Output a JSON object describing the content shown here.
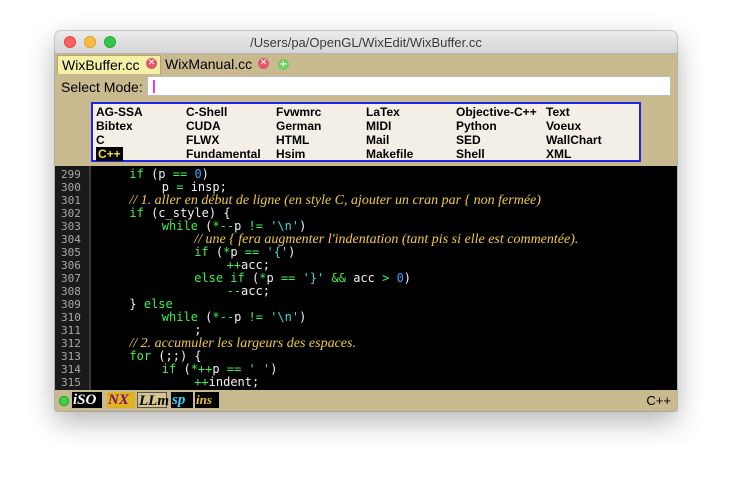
{
  "window": {
    "title": "/Users/pa/OpenGL/WixEdit/WixBuffer.cc"
  },
  "tabs": [
    {
      "label": "WixBuffer.cc",
      "active": true
    },
    {
      "label": "WixManual.cc",
      "active": false
    }
  ],
  "mode_select": {
    "label": "Select Mode:",
    "value": ""
  },
  "modes": [
    [
      "AG-SSA",
      "Bibtex",
      "C",
      "C++"
    ],
    [
      "C-Shell",
      "CUDA",
      "FLWX",
      "Fundamental"
    ],
    [
      "Fvwmrc",
      "German",
      "HTML",
      "Hsim"
    ],
    [
      "LaTex",
      "MIDI",
      "Mail",
      "Makefile"
    ],
    [
      "Objective-C++",
      "Python",
      "SED",
      "Shell"
    ],
    [
      "Text",
      "Voeux",
      "WallChart",
      "XML"
    ]
  ],
  "selected_mode": "C++",
  "code_lines": [
    {
      "no": "299",
      "indent": 4,
      "segs": [
        [
          "kw",
          "if"
        ],
        [
          "tx",
          " (p "
        ],
        [
          "kw",
          "=="
        ],
        [
          "tx",
          " "
        ],
        [
          "nm",
          "0"
        ],
        [
          "tx",
          ")"
        ]
      ]
    },
    {
      "no": "300",
      "indent": 8,
      "segs": [
        [
          "tx",
          "p "
        ],
        [
          "kw",
          "="
        ],
        [
          "tx",
          " insp;"
        ]
      ]
    },
    {
      "no": "301",
      "indent": 4,
      "segs": [
        [
          "cm",
          "// 1. aller en début de ligne (en style C, ajouter un cran par { non fermée)"
        ]
      ]
    },
    {
      "no": "302",
      "indent": 4,
      "segs": [
        [
          "kw",
          "if"
        ],
        [
          "tx",
          " (c_style) {"
        ]
      ]
    },
    {
      "no": "303",
      "indent": 8,
      "segs": [
        [
          "kw",
          "while"
        ],
        [
          "tx",
          " ("
        ],
        [
          "kw",
          "*--"
        ],
        [
          "tx",
          "p "
        ],
        [
          "kw",
          "!="
        ],
        [
          "tx",
          " "
        ],
        [
          "st",
          "'\\n'"
        ],
        [
          "tx",
          ")"
        ]
      ]
    },
    {
      "no": "304",
      "indent": 12,
      "segs": [
        [
          "cm",
          "// une { fera augmenter l'indentation (tant pis si elle est commentée)."
        ]
      ]
    },
    {
      "no": "305",
      "indent": 12,
      "segs": [
        [
          "kw",
          "if"
        ],
        [
          "tx",
          " ("
        ],
        [
          "kw",
          "*"
        ],
        [
          "tx",
          "p "
        ],
        [
          "kw",
          "=="
        ],
        [
          "tx",
          " "
        ],
        [
          "st",
          "'{'"
        ],
        [
          "tx",
          ")"
        ]
      ]
    },
    {
      "no": "306",
      "indent": 16,
      "segs": [
        [
          "kw",
          "++"
        ],
        [
          "tx",
          "acc;"
        ]
      ]
    },
    {
      "no": "307",
      "indent": 12,
      "segs": [
        [
          "kw",
          "else if"
        ],
        [
          "tx",
          " ("
        ],
        [
          "kw",
          "*"
        ],
        [
          "tx",
          "p "
        ],
        [
          "kw",
          "=="
        ],
        [
          "tx",
          " "
        ],
        [
          "st",
          "'}'"
        ],
        [
          "tx",
          " "
        ],
        [
          "kw",
          "&&"
        ],
        [
          "tx",
          " acc "
        ],
        [
          "kw",
          ">"
        ],
        [
          "tx",
          " "
        ],
        [
          "nm",
          "0"
        ],
        [
          "tx",
          ")"
        ]
      ]
    },
    {
      "no": "308",
      "indent": 16,
      "segs": [
        [
          "kw",
          "--"
        ],
        [
          "tx",
          "acc;"
        ]
      ]
    },
    {
      "no": "309",
      "indent": 4,
      "segs": [
        [
          "tx",
          "} "
        ],
        [
          "kw",
          "else"
        ]
      ]
    },
    {
      "no": "310",
      "indent": 8,
      "segs": [
        [
          "kw",
          "while"
        ],
        [
          "tx",
          " ("
        ],
        [
          "kw",
          "*--"
        ],
        [
          "tx",
          "p "
        ],
        [
          "kw",
          "!="
        ],
        [
          "tx",
          " "
        ],
        [
          "st",
          "'\\n'"
        ],
        [
          "tx",
          ")"
        ]
      ]
    },
    {
      "no": "311",
      "indent": 12,
      "segs": [
        [
          "tx",
          ";"
        ]
      ]
    },
    {
      "no": "312",
      "indent": 4,
      "segs": [
        [
          "cm",
          "// 2. accumuler les largeurs des espaces."
        ]
      ]
    },
    {
      "no": "313",
      "indent": 4,
      "segs": [
        [
          "kw",
          "for"
        ],
        [
          "tx",
          " (;;) {"
        ]
      ]
    },
    {
      "no": "314",
      "indent": 8,
      "segs": [
        [
          "kw",
          "if"
        ],
        [
          "tx",
          " ("
        ],
        [
          "kw",
          "*++"
        ],
        [
          "tx",
          "p "
        ],
        [
          "kw",
          "=="
        ],
        [
          "tx",
          " "
        ],
        [
          "st",
          "' '"
        ],
        [
          "tx",
          ")"
        ]
      ]
    },
    {
      "no": "315",
      "indent": 12,
      "segs": [
        [
          "kw",
          "++"
        ],
        [
          "tx",
          "indent;"
        ]
      ]
    }
  ],
  "status": {
    "badges": [
      "iSO",
      "NX",
      "LLm",
      "sp",
      "ins"
    ],
    "language": "C++"
  },
  "colors": {
    "keyword": "#3cf24e",
    "number": "#3aa4ff",
    "string": "#39d8df",
    "comment": "#f3cb3c",
    "selection_border": "#1f25e4",
    "window_bg": "#c9b98e"
  }
}
